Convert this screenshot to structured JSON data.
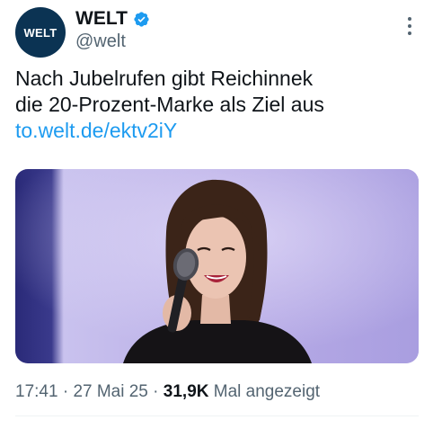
{
  "account": {
    "avatar_text": "WELT",
    "display_name": "WELT",
    "handle": "@welt",
    "verified": true,
    "avatar_color": "#0b3353",
    "verified_color": "#1d9bf0"
  },
  "tweet": {
    "text_line1": "Nach Jubelrufen gibt Reichinnek",
    "text_line2": "die 20-Prozent-Marke als Ziel aus",
    "link": "to.welt.de/ektv2iY",
    "link_color": "#1d9bf0"
  },
  "meta": {
    "time": "17:41",
    "separator1": " · ",
    "date": "27 Mai 25",
    "separator2": " · ",
    "views": "31,9K",
    "views_label": " Mal angezeigt"
  },
  "icons": {
    "more": "more-horizontal-icon",
    "verified": "verified-badge-icon"
  }
}
